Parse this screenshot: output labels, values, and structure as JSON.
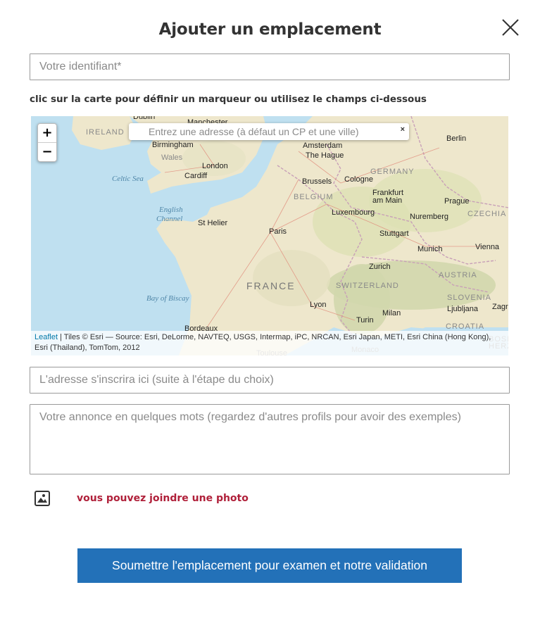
{
  "title": "Ajouter un emplacement",
  "icons": {
    "close": "close-icon",
    "photo": "image-icon"
  },
  "colors": {
    "button": "#2371b8",
    "photo_link": "#b0203a",
    "water": "#bfe0f0",
    "land": "#eee7cc"
  },
  "identifier_field": {
    "placeholder": "Votre identifiant*",
    "value": ""
  },
  "map_hint": "clic sur la carte pour définir un marqueur ou utilisez le champs ci-dessous",
  "map": {
    "zoom_in": "+",
    "zoom_out": "−",
    "geocoder": {
      "placeholder": "Entrez une adresse (à défaut un CP et une ville)",
      "clear": "×"
    },
    "attribution": {
      "link": "Leaflet",
      "text": " | Tiles © Esri — Source: Esri, DeLorme, NAVTEQ, USGS, Intermap, iPC, NRCAN, Esri Japan, METI, Esri China (Hong Kong), Esri (Thailand), TomTom, 2012"
    },
    "countries": [
      "IRELAND",
      "GERMANY",
      "BELGIUM",
      "FRANCE",
      "SWITZERLAND",
      "AUSTRIA",
      "CZECHIA",
      "SLOVENIA",
      "CROATIA",
      "BOSN HERZ"
    ],
    "seas": [
      "Celtic Sea",
      "English Channel",
      "Bay of Biscay"
    ],
    "cities": [
      "Dublin",
      "Manchester",
      "Birmingham",
      "Wales",
      "London",
      "Cardiff",
      "Amsterdam",
      "The Hague",
      "Berlin",
      "Brussels",
      "Cologne",
      "Frankfurt am Main",
      "Prague",
      "Luxembourg",
      "Nuremberg",
      "St Helier",
      "Paris",
      "Stuttgart",
      "Munich",
      "Vienna",
      "Zurich",
      "Lyon",
      "Milan",
      "Ljubljana",
      "Zagr",
      "Turin",
      "Bordeaux",
      "Toulouse",
      "Monaco"
    ]
  },
  "address_field": {
    "placeholder": "L'adresse s'inscrira ici (suite à l'étape du choix)",
    "value": ""
  },
  "description_field": {
    "placeholder": "Votre annonce en quelques mots (regardez d'autres profils pour avoir des exemples)",
    "value": ""
  },
  "photo_link": "vous pouvez joindre une photo",
  "submit_label": "Soumettre l'emplacement pour examen et notre validation"
}
